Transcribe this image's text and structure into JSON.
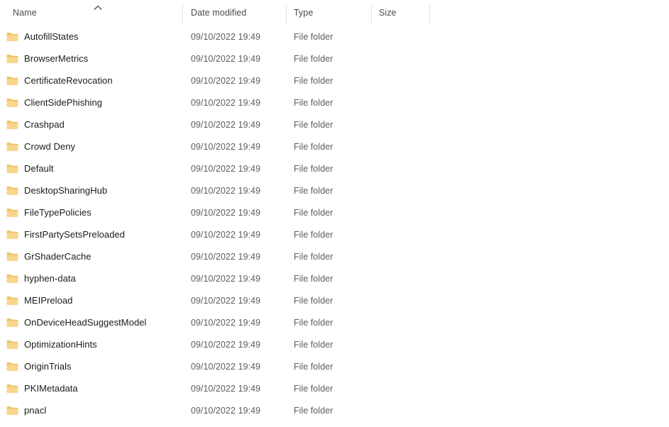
{
  "window": {
    "view_mode": "Details",
    "sort_column": "Name",
    "sort_direction": "ascending",
    "sort_icon": "chevron-up-icon"
  },
  "columns": [
    {
      "key": "name",
      "label": "Name"
    },
    {
      "key": "date_modified",
      "label": "Date modified"
    },
    {
      "key": "type",
      "label": "Type"
    },
    {
      "key": "size",
      "label": "Size"
    }
  ],
  "colors": {
    "background": "#ffffff",
    "header_text": "#4a4a4a",
    "row_text": "#1b1b1b",
    "meta_text": "#5e5e5e",
    "divider": "#e4e4e4",
    "folder_body": "#f8d78c",
    "folder_tab": "#edc263",
    "folder_edge": "#e3b44f"
  },
  "rows": [
    {
      "icon": "folder-icon",
      "name": "AutofillStates",
      "date_modified": "09/10/2022 19:49",
      "type": "File folder",
      "size": ""
    },
    {
      "icon": "folder-icon",
      "name": "BrowserMetrics",
      "date_modified": "09/10/2022 19:49",
      "type": "File folder",
      "size": ""
    },
    {
      "icon": "folder-icon",
      "name": "CertificateRevocation",
      "date_modified": "09/10/2022 19:49",
      "type": "File folder",
      "size": ""
    },
    {
      "icon": "folder-icon",
      "name": "ClientSidePhishing",
      "date_modified": "09/10/2022 19:49",
      "type": "File folder",
      "size": ""
    },
    {
      "icon": "folder-icon",
      "name": "Crashpad",
      "date_modified": "09/10/2022 19:49",
      "type": "File folder",
      "size": ""
    },
    {
      "icon": "folder-icon",
      "name": "Crowd Deny",
      "date_modified": "09/10/2022 19:49",
      "type": "File folder",
      "size": ""
    },
    {
      "icon": "folder-icon",
      "name": "Default",
      "date_modified": "09/10/2022 19:49",
      "type": "File folder",
      "size": ""
    },
    {
      "icon": "folder-icon",
      "name": "DesktopSharingHub",
      "date_modified": "09/10/2022 19:49",
      "type": "File folder",
      "size": ""
    },
    {
      "icon": "folder-icon",
      "name": "FileTypePolicies",
      "date_modified": "09/10/2022 19:49",
      "type": "File folder",
      "size": ""
    },
    {
      "icon": "folder-icon",
      "name": "FirstPartySetsPreloaded",
      "date_modified": "09/10/2022 19:49",
      "type": "File folder",
      "size": ""
    },
    {
      "icon": "folder-icon",
      "name": "GrShaderCache",
      "date_modified": "09/10/2022 19:49",
      "type": "File folder",
      "size": ""
    },
    {
      "icon": "folder-icon",
      "name": "hyphen-data",
      "date_modified": "09/10/2022 19:49",
      "type": "File folder",
      "size": ""
    },
    {
      "icon": "folder-icon",
      "name": "MEIPreload",
      "date_modified": "09/10/2022 19:49",
      "type": "File folder",
      "size": ""
    },
    {
      "icon": "folder-icon",
      "name": "OnDeviceHeadSuggestModel",
      "date_modified": "09/10/2022 19:49",
      "type": "File folder",
      "size": ""
    },
    {
      "icon": "folder-icon",
      "name": "OptimizationHints",
      "date_modified": "09/10/2022 19:49",
      "type": "File folder",
      "size": ""
    },
    {
      "icon": "folder-icon",
      "name": "OriginTrials",
      "date_modified": "09/10/2022 19:49",
      "type": "File folder",
      "size": ""
    },
    {
      "icon": "folder-icon",
      "name": "PKIMetadata",
      "date_modified": "09/10/2022 19:49",
      "type": "File folder",
      "size": ""
    },
    {
      "icon": "folder-icon",
      "name": "pnacl",
      "date_modified": "09/10/2022 19:49",
      "type": "File folder",
      "size": ""
    }
  ]
}
